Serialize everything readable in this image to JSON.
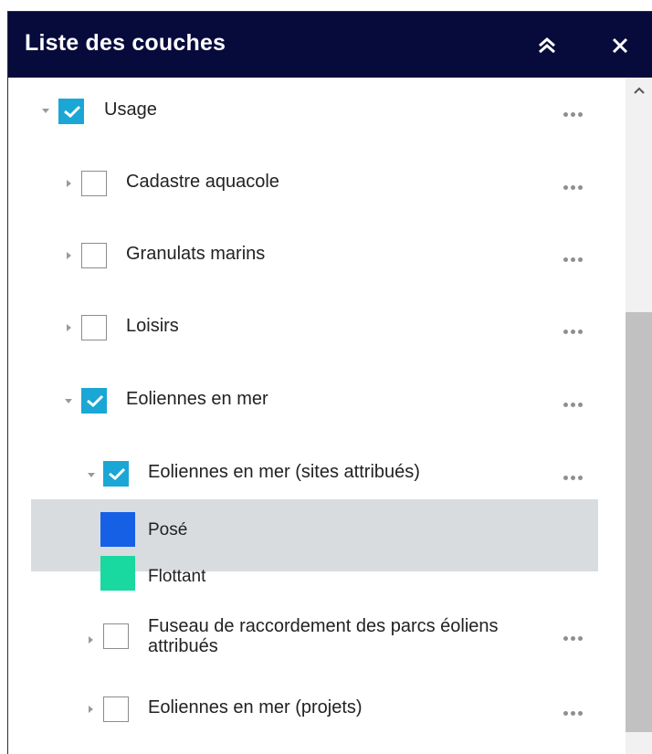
{
  "panel": {
    "title": "Liste des couches",
    "collapse_icon": "double-chevron-up-icon",
    "close_icon": "close-icon"
  },
  "layers": [
    {
      "label": "Usage",
      "checked": true,
      "expanded": true
    },
    {
      "label": "Cadastre aquacole",
      "checked": false,
      "expanded": false
    },
    {
      "label": "Granulats marins",
      "checked": false,
      "expanded": false
    },
    {
      "label": "Loisirs",
      "checked": false,
      "expanded": false
    },
    {
      "label": "Eoliennes en mer",
      "checked": true,
      "expanded": true
    },
    {
      "label": "Eoliennes en mer (sites attribués)",
      "checked": true,
      "expanded": true,
      "selected": true
    },
    {
      "label": "Fuseau de raccordement des parcs éoliens attribués",
      "checked": false,
      "expanded": false
    },
    {
      "label": "Eoliennes en mer (projets)",
      "checked": false,
      "expanded": false
    }
  ],
  "legend": [
    {
      "label": "Posé",
      "color": "#1660e6"
    },
    {
      "label": "Flottant",
      "color": "#19d8a0"
    }
  ],
  "colors": {
    "header_bg": "#070b3c",
    "checkbox_checked": "#1aa7d6",
    "selected_row_bg": "#d8dcdf"
  }
}
